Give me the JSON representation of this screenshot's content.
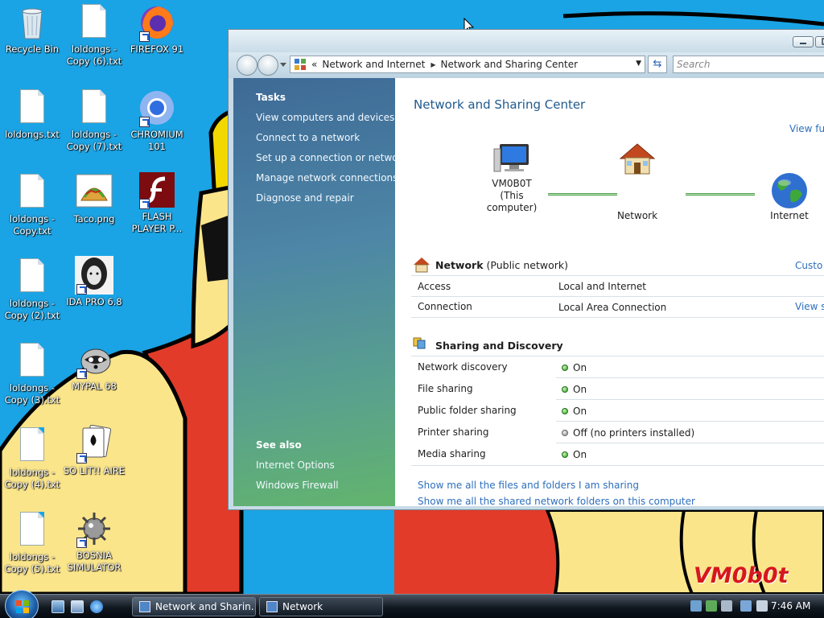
{
  "desktop": {
    "icons": [
      {
        "label": "Recycle Bin"
      },
      {
        "label": "loldongs - Copy (6).txt"
      },
      {
        "label": "FIREFOX 91"
      },
      {
        "label": "loldongs.txt"
      },
      {
        "label": "loldongs - Copy (7).txt"
      },
      {
        "label": "CHROMIUM 101"
      },
      {
        "label": "loldongs - Copy.txt"
      },
      {
        "label": "Taco.png"
      },
      {
        "label": "FLASH PLAYER P..."
      },
      {
        "label": "loldongs - Copy (2).txt"
      },
      {
        "label": "IDA PRO 6.8"
      },
      {
        "label": "loldongs - Copy (3).txt"
      },
      {
        "label": "MYPAL 68"
      },
      {
        "label": "loldongs - Copy (4).txt"
      },
      {
        "label": "SO LIT!! AIRE"
      },
      {
        "label": "loldongs - Copy (5).txt"
      },
      {
        "label": "BOSNIA SIMULATOR"
      }
    ],
    "watermark": "VM0b0t",
    "colors": {
      "background": "#1aa4e5",
      "shirt": "#e23b2a",
      "skin": "#fbe58a",
      "hair": "#f2d800"
    }
  },
  "window": {
    "address": {
      "parts": [
        "Network and Internet",
        "Network and Sharing Center"
      ],
      "prefix": "«"
    },
    "search_placeholder": "Search",
    "sidebar": {
      "tasks_heading": "Tasks",
      "tasks": [
        "View computers and devices",
        "Connect to a network",
        "Set up a connection or network",
        "Manage network connections",
        "Diagnose and repair"
      ],
      "see_also_heading": "See also",
      "see_also": [
        "Internet Options",
        "Windows Firewall"
      ]
    },
    "main": {
      "title": "Network and Sharing Center",
      "view_full_map": "View ful",
      "map": {
        "computer_name": "VM0B0T",
        "computer_sub": "(This computer)",
        "network": "Network",
        "internet": "Internet"
      },
      "network_section": {
        "name": "Network",
        "type": "(Public network)",
        "customize": "Custo",
        "rows": [
          {
            "label": "Access",
            "value": "Local and Internet"
          },
          {
            "label": "Connection",
            "value": "Local Area Connection",
            "link": "View s"
          }
        ]
      },
      "sharing_section": {
        "title": "Sharing and Discovery",
        "rows": [
          {
            "label": "Network discovery",
            "value": "On",
            "state": "on"
          },
          {
            "label": "File sharing",
            "value": "On",
            "state": "on"
          },
          {
            "label": "Public folder sharing",
            "value": "On",
            "state": "on"
          },
          {
            "label": "Printer sharing",
            "value": "Off (no printers installed)",
            "state": "off"
          },
          {
            "label": "Media sharing",
            "value": "On",
            "state": "on"
          }
        ]
      },
      "bottom_links": [
        "Show me all the files and folders I am sharing",
        "Show me all the shared network folders on this computer"
      ]
    }
  },
  "taskbar": {
    "tasks": [
      {
        "label": "Network and Sharin...",
        "active": true
      },
      {
        "label": "Network",
        "active": false
      }
    ],
    "clock": "7:46 AM"
  }
}
